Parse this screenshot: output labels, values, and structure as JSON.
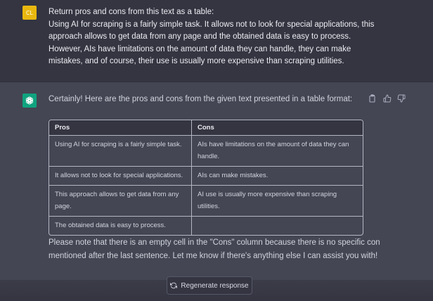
{
  "user_message": {
    "avatar_initials": "CL",
    "lines": [
      "Return pros and cons from this text as a table:",
      "Using AI for scraping is a fairly simple task. It allows not to look for special applications, this",
      "approach allows to get data from any page and the obtained data is easy to process.",
      "However, AIs have limitations on the amount of data they can handle, they can make",
      "mistakes, and of course, their use is usually more expensive than scraping utilities."
    ]
  },
  "assistant_message": {
    "intro": "Certainly! Here are the pros and cons from the given text presented in a table format:",
    "table": {
      "headers": [
        "Pros",
        "Cons"
      ],
      "rows": [
        [
          "Using AI for scraping is a fairly simple task.",
          "AIs have limitations on the amount of data they can handle."
        ],
        [
          "It allows not to look for special applications.",
          "AIs can make mistakes."
        ],
        [
          "This approach allows to get data from any page.",
          "AI use is usually more expensive than scraping utilities."
        ],
        [
          "The obtained data is easy to process.",
          ""
        ]
      ]
    },
    "note_lines": [
      "Please note that there is an empty cell in the \"Cons\" column because there is no specific con",
      "mentioned after the last sentence. Let me know if there's anything else I can assist you with!"
    ],
    "action_icons": [
      "copy-icon",
      "thumbs-up-icon",
      "thumbs-down-icon"
    ]
  },
  "regenerate_label": "Regenerate response",
  "colors": {
    "user_bg": "#343541",
    "assistant_bg": "#444654",
    "user_avatar": "#e9b80f",
    "ai_avatar": "#10a37f"
  }
}
